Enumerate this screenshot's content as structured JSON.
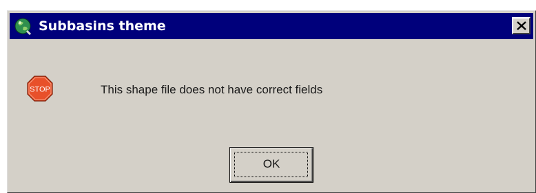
{
  "window": {
    "title": "Subbasins theme",
    "app_icon": "globe-icon",
    "close_icon": "close-icon",
    "titlebar_color": "#00007b",
    "face_color": "#d4d0c8"
  },
  "message": {
    "icon": "stop-icon",
    "icon_text": "STOP",
    "icon_color": "#e8502a",
    "text": "This shape file does not have correct fields"
  },
  "buttons": {
    "ok_label": "OK"
  }
}
